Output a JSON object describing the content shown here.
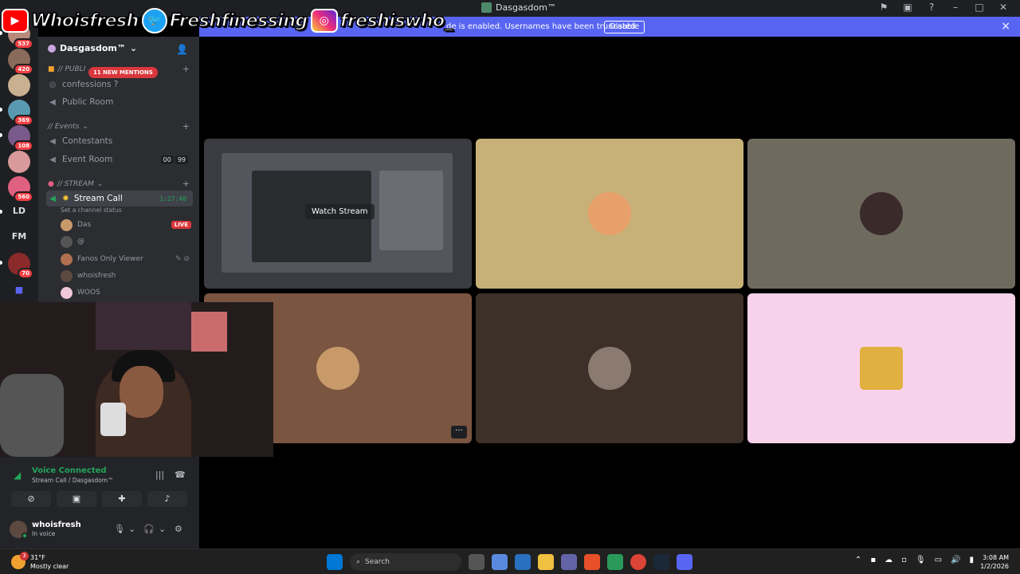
{
  "window": {
    "title": "Dasgasdom™",
    "controls": [
      "flag-icon",
      "screen-icon",
      "help-icon",
      "minimize-icon",
      "maximize-icon",
      "close-icon"
    ]
  },
  "overlay": {
    "youtube": "Whoisfresh",
    "twitter": "Freshfinessing",
    "instagram": "freshiswho_"
  },
  "notice": {
    "text": "de is enabled. Usernames have been truncated.",
    "button": "Disable",
    "close": "×"
  },
  "rail": {
    "servers": [
      {
        "badge": "537",
        "color": "#b88a7a"
      },
      {
        "badge": "420",
        "color": "#8a6a5a"
      },
      {
        "badge": "",
        "color": "#c8b090"
      },
      {
        "badge": "369",
        "color": "#5a9ab0"
      },
      {
        "badge": "108",
        "color": "#7a5a8a"
      },
      {
        "badge": "",
        "color": "#d89a9a"
      },
      {
        "badge": "560",
        "color": "#e06080"
      }
    ],
    "text_servers": [
      "LD",
      "FM"
    ],
    "last_badge": "70"
  },
  "sidebar": {
    "server_name": "Dasgasdom™",
    "mentions": "11 NEW MENTIONS",
    "categories": {
      "public": "// PUBLI",
      "events": "// Events",
      "stream": "// STREAM"
    },
    "channels": {
      "confessions": "confessions ?",
      "public_room": "Public Room",
      "contestants": "Contestants",
      "event_room": "Event Room",
      "event_count_a": "00",
      "event_count_b": "99",
      "stream_call": "Stream Call",
      "stream_timer": "1:27:40",
      "stream_status": "Set a channel status"
    },
    "members": [
      {
        "name": "Das",
        "live": "LIVE",
        "color": "#c89a6a"
      },
      {
        "name": "@",
        "color": "#555"
      },
      {
        "name": "Fanos Only Viewer",
        "color": "#b07050"
      },
      {
        "name": "whoisfresh",
        "color": "#5c4a40"
      },
      {
        "name": "WOOS",
        "color": "#f0c8d8"
      }
    ]
  },
  "stage": {
    "watch_label": "Watch Stream",
    "more_label": "···",
    "tiles": [
      {
        "bg": "#3a3c42",
        "avatar": ""
      },
      {
        "bg": "#c8b178",
        "avatar": "#e8a06a"
      },
      {
        "bg": "#6e6a5e",
        "avatar": "#3a2a2a"
      },
      {
        "bg": "#7a5540",
        "avatar": "#c89a6a"
      },
      {
        "bg": "#3d3028",
        "avatar": "#8a7a70"
      },
      {
        "bg": "#f8d2ea",
        "avatar": "#e0b040"
      }
    ]
  },
  "voice": {
    "title": "Voice Connected",
    "subtitle": "Stream Call / Dasgasdom™",
    "user": "whoisfresh",
    "user_status": "In voice"
  },
  "taskbar": {
    "temp": "31°F",
    "weather": "Mostly clear",
    "weather_badge": "3",
    "search": "Search",
    "time": "3:08 AM",
    "date": "1/2/2026"
  }
}
